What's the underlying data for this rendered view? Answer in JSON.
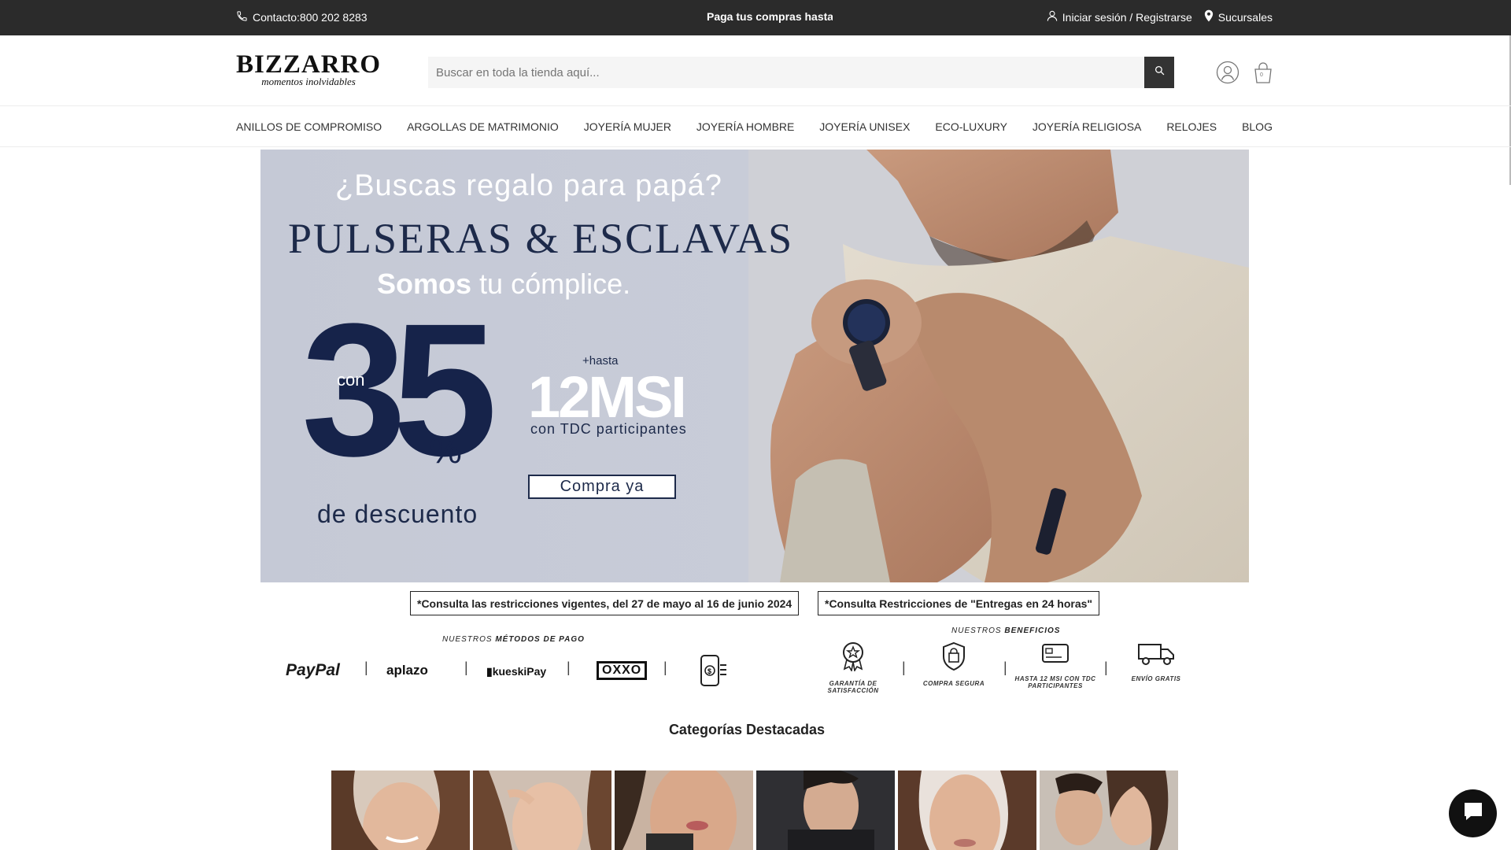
{
  "topbar": {
    "contact": "Contacto:800 202 8283",
    "promo": "Paga tus compras hasta",
    "login": "Iniciar sesión / Registrarse",
    "stores": "Sucursales"
  },
  "header": {
    "brand": "BIZZARRO",
    "tagline": "momentos inolvidables",
    "search_placeholder": "Buscar en toda la tienda aquí...",
    "cart_count": "0"
  },
  "nav": {
    "items": [
      "ANILLOS DE COMPROMISO",
      "ARGOLLAS DE MATRIMONIO",
      "JOYERÍA MUJER",
      "JOYERÍA HOMBRE",
      "JOYERÍA UNISEX",
      "ECO-LUXURY",
      "JOYERÍA RELIGIOSA",
      "RELOJES",
      "BLOG"
    ]
  },
  "hero": {
    "question": "¿Buscas regalo para papá?",
    "headline": "PULSERAS & ESCLAVAS",
    "sub_bold": "Somos",
    "sub_rest": "tu cómplice.",
    "con": "con",
    "discount": "35",
    "percent": "%",
    "discount_label": "de descuento",
    "hasta": "+hasta",
    "msi": "12MSI",
    "msi_detail": "con TDC participantes",
    "cta": "Compra ya"
  },
  "notices": {
    "restrictions": "*Consulta las restricciones vigentes, del 27 de mayo al 16 de junio 2024",
    "delivery": "*Consulta Restricciones de \"Entregas en 24 horas\""
  },
  "payments": {
    "title_pre": "NUESTROS",
    "title_bold": "MÉTODOS DE PAGO",
    "methods": [
      "PayPal",
      "aplazo",
      "kueskiPay",
      "OXXO"
    ]
  },
  "benefits": {
    "title_pre": "NUESTROS",
    "title_bold": "BENEFICIOS",
    "items": [
      "GARANTÍA DE SATISFACCIÓN",
      "COMPRA SEGURA",
      "HASTA 12 MSI CON TDC PARTICIPANTES",
      "ENVÍO GRATIS"
    ]
  },
  "categories": {
    "title": "Categorías Destacadas"
  },
  "colors": {
    "topbar": "#2b2b2b",
    "navy": "#16234a",
    "hero_bg": "#c6cad7"
  }
}
